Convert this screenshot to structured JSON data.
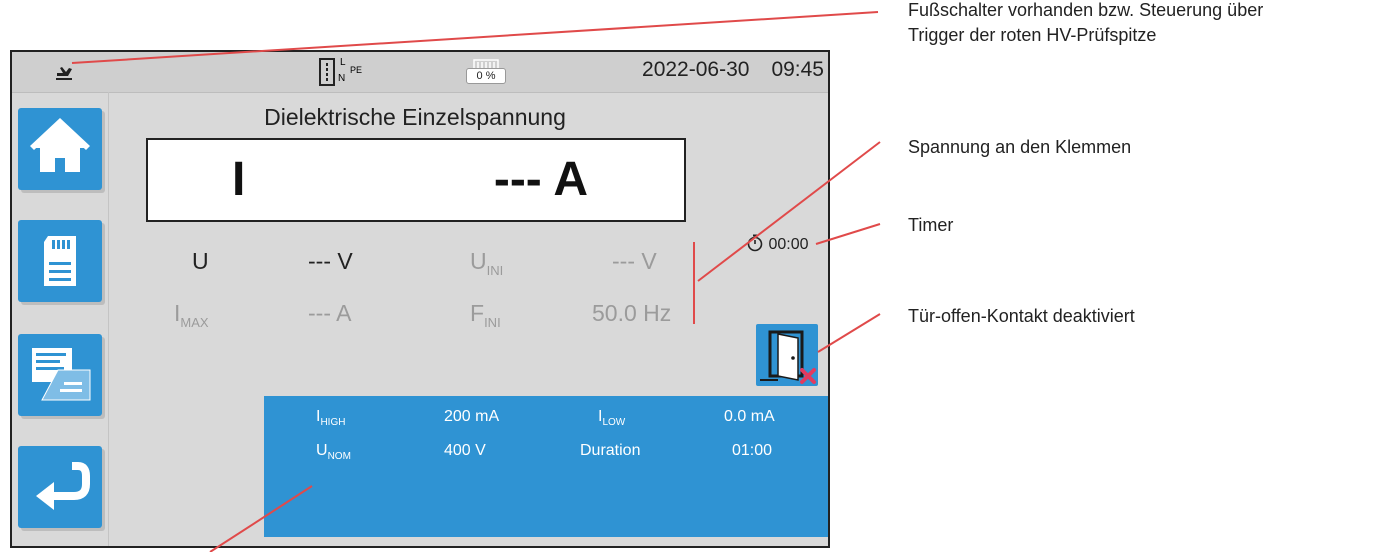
{
  "statusbar": {
    "plug_labels": {
      "l": "L",
      "n": "N",
      "pe": "PE"
    },
    "battery_percent": "0 %",
    "date": "2022-06-30",
    "time": "09:45"
  },
  "sidebar": {
    "items": [
      {
        "icon": "home-icon"
      },
      {
        "icon": "memory-card-icon"
      },
      {
        "icon": "report-icon"
      },
      {
        "icon": "back-arrow-icon"
      }
    ]
  },
  "main": {
    "title": "Dielektrische Einzelspannung",
    "display": {
      "quantity": "I",
      "value": "--- A"
    },
    "measurements": {
      "u": {
        "label": "U",
        "value": "--- V"
      },
      "u_ini": {
        "label": "U",
        "sub": "INI",
        "value": "--- V"
      },
      "i_max": {
        "label": "I",
        "sub": "MAX",
        "value": "--- A"
      },
      "f_ini": {
        "label": "F",
        "sub": "INI",
        "value": "50.0 Hz"
      }
    },
    "timer": "00:00",
    "door_contact_icon": "door-open-disabled-icon"
  },
  "params_panel": {
    "i_high": {
      "label": "I",
      "sub": "HIGH",
      "value": "200 mA"
    },
    "i_low": {
      "label": "I",
      "sub": "LOW",
      "value": "0.0 mA"
    },
    "u_nom": {
      "label": "U",
      "sub": "NOM",
      "value": "400 V"
    },
    "duration": {
      "label": "Duration",
      "value": "01:00"
    }
  },
  "callouts": {
    "footswitch_line1": "Fußschalter vorhanden bzw. Steuerung über",
    "footswitch_line2": "Trigger der roten HV-Prüfspitze",
    "voltage_terminals": "Spannung an den Klemmen",
    "timer": "Timer",
    "door_contact": "Tür-offen-Kontakt deaktiviert"
  },
  "colors": {
    "accent_blue": "#2f93d3",
    "callout_red": "#e04a4a",
    "screen_grey": "#d9d9d9"
  }
}
